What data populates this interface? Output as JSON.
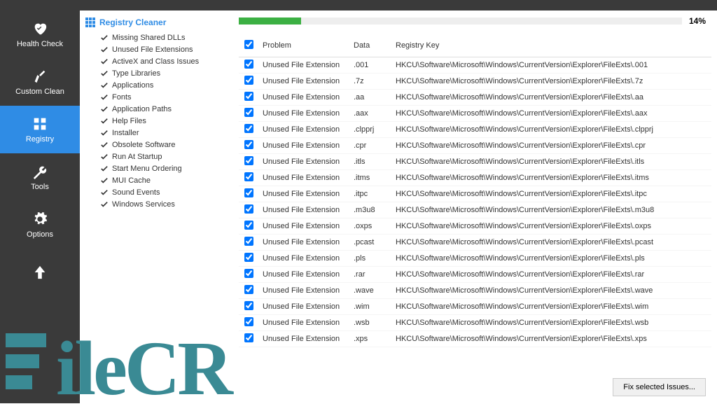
{
  "sidebar": {
    "items": [
      {
        "label": "Health Check"
      },
      {
        "label": "Custom Clean"
      },
      {
        "label": "Registry"
      },
      {
        "label": "Tools"
      },
      {
        "label": "Options"
      }
    ]
  },
  "categories": {
    "title": "Registry Cleaner",
    "items": [
      "Missing Shared DLLs",
      "Unused File Extensions",
      "ActiveX and Class Issues",
      "Type Libraries",
      "Applications",
      "Fonts",
      "Application Paths",
      "Help Files",
      "Installer",
      "Obsolete Software",
      "Run At Startup",
      "Start Menu Ordering",
      "MUI Cache",
      "Sound Events",
      "Windows Services"
    ]
  },
  "progress": {
    "percent": 14,
    "label": "14%"
  },
  "table": {
    "headers": {
      "problem": "Problem",
      "data": "Data",
      "key": "Registry Key"
    },
    "rows": [
      {
        "problem": "Unused File Extension",
        "data": ".001",
        "key": "HKCU\\Software\\Microsoft\\Windows\\CurrentVersion\\Explorer\\FileExts\\.001"
      },
      {
        "problem": "Unused File Extension",
        "data": ".7z",
        "key": "HKCU\\Software\\Microsoft\\Windows\\CurrentVersion\\Explorer\\FileExts\\.7z"
      },
      {
        "problem": "Unused File Extension",
        "data": ".aa",
        "key": "HKCU\\Software\\Microsoft\\Windows\\CurrentVersion\\Explorer\\FileExts\\.aa"
      },
      {
        "problem": "Unused File Extension",
        "data": ".aax",
        "key": "HKCU\\Software\\Microsoft\\Windows\\CurrentVersion\\Explorer\\FileExts\\.aax"
      },
      {
        "problem": "Unused File Extension",
        "data": ".clpprj",
        "key": "HKCU\\Software\\Microsoft\\Windows\\CurrentVersion\\Explorer\\FileExts\\.clpprj"
      },
      {
        "problem": "Unused File Extension",
        "data": ".cpr",
        "key": "HKCU\\Software\\Microsoft\\Windows\\CurrentVersion\\Explorer\\FileExts\\.cpr"
      },
      {
        "problem": "Unused File Extension",
        "data": ".itls",
        "key": "HKCU\\Software\\Microsoft\\Windows\\CurrentVersion\\Explorer\\FileExts\\.itls"
      },
      {
        "problem": "Unused File Extension",
        "data": ".itms",
        "key": "HKCU\\Software\\Microsoft\\Windows\\CurrentVersion\\Explorer\\FileExts\\.itms"
      },
      {
        "problem": "Unused File Extension",
        "data": ".itpc",
        "key": "HKCU\\Software\\Microsoft\\Windows\\CurrentVersion\\Explorer\\FileExts\\.itpc"
      },
      {
        "problem": "Unused File Extension",
        "data": ".m3u8",
        "key": "HKCU\\Software\\Microsoft\\Windows\\CurrentVersion\\Explorer\\FileExts\\.m3u8"
      },
      {
        "problem": "Unused File Extension",
        "data": ".oxps",
        "key": "HKCU\\Software\\Microsoft\\Windows\\CurrentVersion\\Explorer\\FileExts\\.oxps"
      },
      {
        "problem": "Unused File Extension",
        "data": ".pcast",
        "key": "HKCU\\Software\\Microsoft\\Windows\\CurrentVersion\\Explorer\\FileExts\\.pcast"
      },
      {
        "problem": "Unused File Extension",
        "data": ".pls",
        "key": "HKCU\\Software\\Microsoft\\Windows\\CurrentVersion\\Explorer\\FileExts\\.pls"
      },
      {
        "problem": "Unused File Extension",
        "data": ".rar",
        "key": "HKCU\\Software\\Microsoft\\Windows\\CurrentVersion\\Explorer\\FileExts\\.rar"
      },
      {
        "problem": "Unused File Extension",
        "data": ".wave",
        "key": "HKCU\\Software\\Microsoft\\Windows\\CurrentVersion\\Explorer\\FileExts\\.wave"
      },
      {
        "problem": "Unused File Extension",
        "data": ".wim",
        "key": "HKCU\\Software\\Microsoft\\Windows\\CurrentVersion\\Explorer\\FileExts\\.wim"
      },
      {
        "problem": "Unused File Extension",
        "data": ".wsb",
        "key": "HKCU\\Software\\Microsoft\\Windows\\CurrentVersion\\Explorer\\FileExts\\.wsb"
      },
      {
        "problem": "Unused File Extension",
        "data": ".xps",
        "key": "HKCU\\Software\\Microsoft\\Windows\\CurrentVersion\\Explorer\\FileExts\\.xps"
      }
    ]
  },
  "buttons": {
    "fix": "Fix selected Issues..."
  },
  "watermark": "ileCR"
}
